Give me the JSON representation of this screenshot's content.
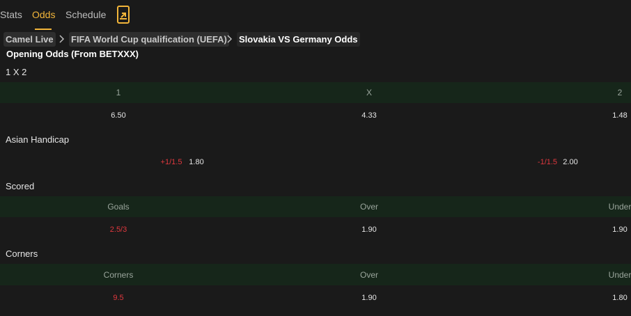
{
  "tabs": [
    {
      "label": "Stats"
    },
    {
      "label": "Odds"
    },
    {
      "label": "Schedule"
    }
  ],
  "breadcrumb": {
    "home": "Camel Live",
    "competition": "FIFA World Cup qualification (UEFA)",
    "current": "Slovakia VS Germany Odds"
  },
  "opening_odds_title": "Opening Odds (From BETXXX)",
  "markets": {
    "x12": {
      "title": "1 X 2",
      "headers": [
        "1",
        "X",
        "2"
      ],
      "values": [
        "6.50",
        "4.33",
        "1.48"
      ]
    },
    "asian_handicap": {
      "title": "Asian Handicap",
      "home_line": "+1/1.5",
      "home_odds": "1.80",
      "away_line": "-1/1.5",
      "away_odds": "2.00"
    },
    "scored": {
      "title": "Scored",
      "headers": [
        "Goals",
        "Over",
        "Under"
      ],
      "line": "2.5/3",
      "over": "1.90",
      "under": "1.90"
    },
    "corners": {
      "title": "Corners",
      "headers": [
        "Corners",
        "Over",
        "Under"
      ],
      "line": "9.5",
      "over": "1.90",
      "under": "1.80"
    }
  },
  "colors": {
    "accent": "#f2b53a",
    "header_bg": "#16261a",
    "handicap_red": "#e0383e",
    "background": "#1a1a1a"
  }
}
